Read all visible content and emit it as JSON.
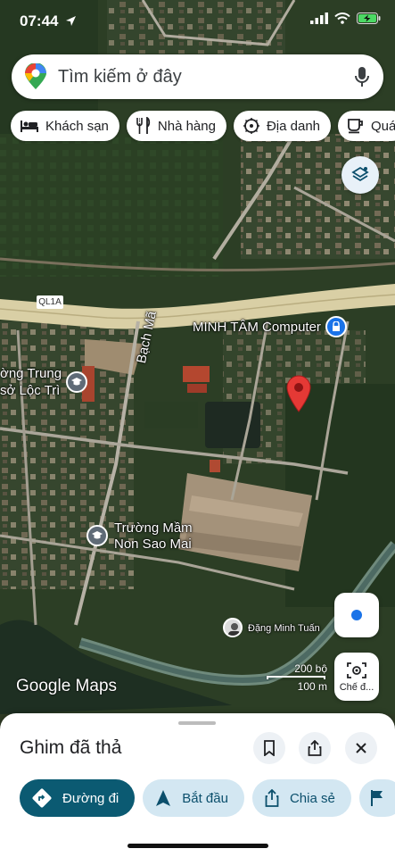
{
  "status": {
    "time": "07:44"
  },
  "search": {
    "placeholder": "Tìm kiếm ở đây"
  },
  "chips": [
    {
      "label": "Khách sạn",
      "icon": "bed-icon"
    },
    {
      "label": "Nhà hàng",
      "icon": "restaurant-icon"
    },
    {
      "label": "Địa danh",
      "icon": "landmark-icon"
    },
    {
      "label": "Quá",
      "icon": "coffee-icon"
    }
  ],
  "map": {
    "labels": {
      "highway_badge": "QL1A",
      "business": "MINH TÂM Computer",
      "road": "Bạch Mã",
      "school_1a": "ờng Trung",
      "school_1b": "sở Lộc Trì",
      "school_2a": "Trường Mầm",
      "school_2b": "Non Sao Mai",
      "user": "Đặng Minh Tuấn"
    },
    "watermark": "Google Maps",
    "scale": {
      "top": "200 bộ",
      "bottom": "100 m"
    },
    "mode_button": "Chế đ..."
  },
  "sheet": {
    "title": "Ghim đã thả",
    "actions": [
      {
        "label": "Đường đi",
        "icon": "directions-icon"
      },
      {
        "label": "Bắt đầu",
        "icon": "navigation-icon"
      },
      {
        "label": "Chia sẻ",
        "icon": "share-icon"
      }
    ]
  },
  "colors": {
    "accent": "#0b5a72",
    "action_bg": "#d3e7f2",
    "pin": "#e53935",
    "poi": "#1a73e8"
  }
}
